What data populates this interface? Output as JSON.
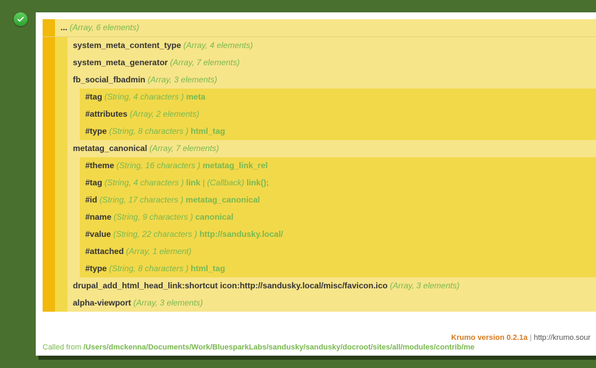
{
  "rows": [
    {
      "bars": [
        "o"
      ],
      "bg": "p",
      "key": "...",
      "meta": "(Array, 6 elements)"
    },
    {
      "bars": [
        "o",
        "y"
      ],
      "bg": "p",
      "key": "system_meta_content_type",
      "meta": "(Array, 4 elements)"
    },
    {
      "bars": [
        "o",
        "y"
      ],
      "bg": "p",
      "key": "system_meta_generator",
      "meta": "(Array, 7 elements)"
    },
    {
      "bars": [
        "o",
        "y"
      ],
      "bg": "p",
      "key": "fb_social_fbadmin",
      "meta": "(Array, 3 elements)"
    },
    {
      "bars": [
        "o",
        "y",
        "p"
      ],
      "bg": "y",
      "key": "#tag",
      "meta": "(String, 4 characters )",
      "val": "meta"
    },
    {
      "bars": [
        "o",
        "y",
        "p"
      ],
      "bg": "y",
      "key": "#attributes",
      "meta": "(Array, 2 elements)"
    },
    {
      "bars": [
        "o",
        "y",
        "p"
      ],
      "bg": "y",
      "key": "#type",
      "meta": "(String, 8 characters )",
      "val": "html_tag"
    },
    {
      "bars": [
        "o",
        "y"
      ],
      "bg": "p",
      "key": "metatag_canonical",
      "meta": "(Array, 7 elements)"
    },
    {
      "bars": [
        "o",
        "y",
        "p"
      ],
      "bg": "y",
      "key": "#theme",
      "meta": "(String, 16 characters )",
      "val": "metatag_link_rel"
    },
    {
      "bars": [
        "o",
        "y",
        "p"
      ],
      "bg": "y",
      "key": "#tag",
      "meta": "(String, 4 characters )",
      "val": "link",
      "extra_sep": " | ",
      "extra_cb": "(Callback)",
      "extra_val": " link();"
    },
    {
      "bars": [
        "o",
        "y",
        "p"
      ],
      "bg": "y",
      "key": "#id",
      "meta": "(String, 17 characters )",
      "val": "metatag_canonical"
    },
    {
      "bars": [
        "o",
        "y",
        "p"
      ],
      "bg": "y",
      "key": "#name",
      "meta": "(String, 9 characters )",
      "val": "canonical"
    },
    {
      "bars": [
        "o",
        "y",
        "p"
      ],
      "bg": "y",
      "key": "#value",
      "meta": "(String, 22 characters )",
      "val": "http://sandusky.local/"
    },
    {
      "bars": [
        "o",
        "y",
        "p"
      ],
      "bg": "y",
      "key": "#attached",
      "meta": "(Array, 1 element)"
    },
    {
      "bars": [
        "o",
        "y",
        "p"
      ],
      "bg": "y",
      "key": "#type",
      "meta": "(String, 8 characters )",
      "val": "html_tag"
    },
    {
      "bars": [
        "o",
        "y"
      ],
      "bg": "p",
      "key": "drupal_add_html_head_link:shortcut icon:http://sandusky.local/misc/favicon.ico",
      "meta": "(Array, 3 elements)"
    },
    {
      "bars": [
        "o",
        "y"
      ],
      "bg": "p",
      "key": "alpha-viewport",
      "meta": "(Array, 3 elements)"
    }
  ],
  "footer": {
    "version_label": "Krumo version 0.2.1a",
    "pipe": " | ",
    "url": "http://krumo.sour",
    "called_label": "Called from ",
    "called_path": "/Users/dmckenna/Documents/Work/BluesparkLabs/sandusky/sandusky/docroot/sites/all/modules/contrib/me"
  }
}
